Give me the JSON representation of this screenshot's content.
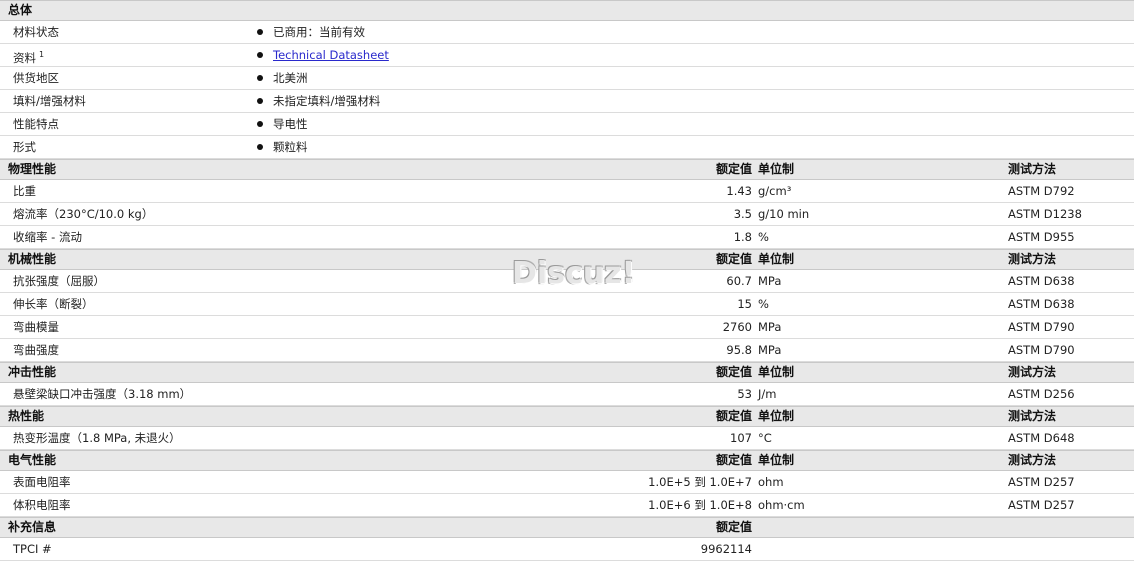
{
  "general": {
    "title": "总体",
    "rows": [
      {
        "name": "材料状态",
        "value": "已商用：当前有效"
      },
      {
        "name": "资料",
        "sup": "1",
        "value": "Technical Datasheet"
      },
      {
        "name": "供货地区",
        "value": "北美洲"
      },
      {
        "name": "填料/增强材料",
        "value": "未指定填料/增强材料"
      },
      {
        "name": "性能特点",
        "value": "导电性"
      },
      {
        "name": "形式",
        "value": "颗粒料"
      }
    ]
  },
  "col_labels": {
    "value": "额定值",
    "unit": "单位制",
    "method": "测试方法"
  },
  "sections": [
    {
      "title": "物理性能",
      "rows": [
        {
          "name": "比重",
          "value": "1.43",
          "unit": "g/cm³",
          "method": "ASTM D792"
        },
        {
          "name": "熔流率（230°C/10.0 kg）",
          "value": "3.5",
          "unit": "g/10 min",
          "method": "ASTM D1238"
        },
        {
          "name": "收缩率 - 流动",
          "value": "1.8",
          "unit": "%",
          "method": "ASTM D955"
        }
      ]
    },
    {
      "title": "机械性能",
      "rows": [
        {
          "name": "抗张强度（屈服）",
          "value": "60.7",
          "unit": "MPa",
          "method": "ASTM D638"
        },
        {
          "name": "伸长率（断裂）",
          "value": "15",
          "unit": "%",
          "method": "ASTM D638"
        },
        {
          "name": "弯曲模量",
          "value": "2760",
          "unit": "MPa",
          "method": "ASTM D790"
        },
        {
          "name": "弯曲强度",
          "value": "95.8",
          "unit": "MPa",
          "method": "ASTM D790"
        }
      ]
    },
    {
      "title": "冲击性能",
      "rows": [
        {
          "name": "悬壁梁缺口冲击强度（3.18 mm）",
          "value": "53",
          "unit": "J/m",
          "method": "ASTM D256"
        }
      ]
    },
    {
      "title": "热性能",
      "rows": [
        {
          "name": "热变形温度（1.8 MPa, 未退火）",
          "value": "107",
          "unit": "°C",
          "method": "ASTM D648"
        }
      ]
    },
    {
      "title": "电气性能",
      "rows": [
        {
          "name": "表面电阻率",
          "value": "1.0E+5 到  1.0E+7",
          "unit": "ohm",
          "method": "ASTM D257"
        },
        {
          "name": "体积电阻率",
          "value": "1.0E+6 到  1.0E+8",
          "unit": "ohm·cm",
          "method": "ASTM D257"
        }
      ]
    },
    {
      "title": "补充信息",
      "hide_unit_method": true,
      "rows": [
        {
          "name": "TPCI #",
          "value": "9962114",
          "unit": "",
          "method": ""
        }
      ]
    }
  ],
  "watermark": "Discuz!"
}
